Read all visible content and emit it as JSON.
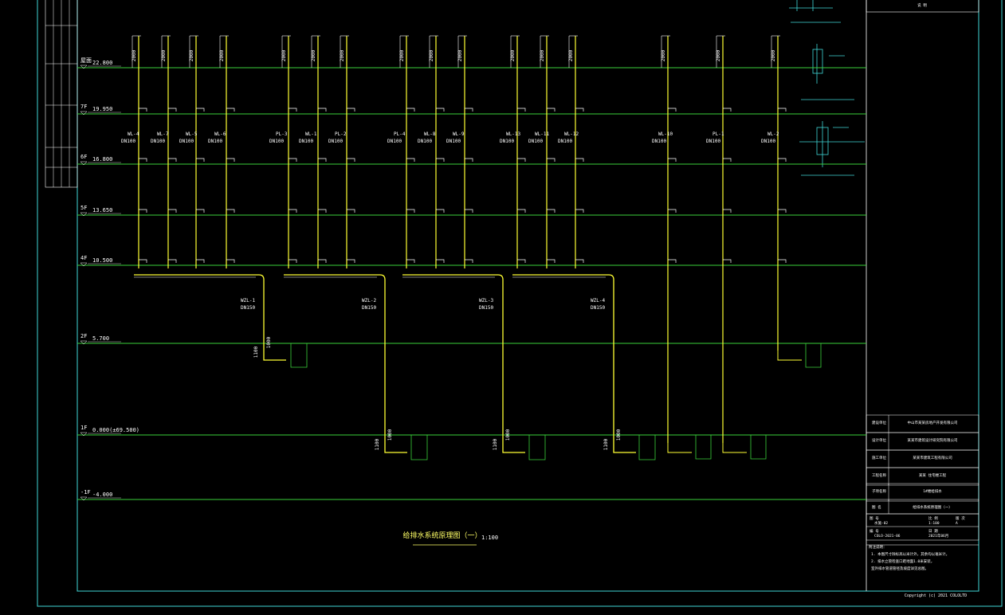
{
  "drawing": {
    "title": "给排水系统原理图（一）",
    "scale": "1:100",
    "copyright": "Copyright (c) 2021 COLOLTD"
  },
  "levels": [
    {
      "label": "22.800",
      "tag": "屋面"
    },
    {
      "label": "19.950",
      "tag": "7F"
    },
    {
      "label": "16.800",
      "tag": "6F"
    },
    {
      "label": "13.650",
      "tag": "5F"
    },
    {
      "label": "10.500",
      "tag": "4F"
    },
    {
      "label": "5.700",
      "tag": "2F"
    },
    {
      "label": "0.000(±69.500)",
      "tag": "1F"
    },
    {
      "label": "-4.000",
      "tag": "-1F"
    }
  ],
  "pipes": [
    {
      "name": "WL-4",
      "size": "DN100",
      "dim": "2000"
    },
    {
      "name": "WL-7",
      "size": "DN100",
      "dim": "2000"
    },
    {
      "name": "WL-5",
      "size": "DN100",
      "dim": "2000"
    },
    {
      "name": "WL-6",
      "size": "DN100",
      "dim": "2000"
    },
    {
      "name": "PL-3",
      "size": "DN100",
      "dim": "2000"
    },
    {
      "name": "WL-1",
      "size": "DN100",
      "dim": "2000"
    },
    {
      "name": "PL-2",
      "size": "DN100",
      "dim": "2000"
    },
    {
      "name": "PL-4",
      "size": "DN100",
      "dim": "2000"
    },
    {
      "name": "WL-8",
      "size": "DN100",
      "dim": "2000"
    },
    {
      "name": "WL-9",
      "size": "DN100",
      "dim": "2000"
    },
    {
      "name": "WL-13",
      "size": "DN100",
      "dim": "2000"
    },
    {
      "name": "WL-11",
      "size": "DN100",
      "dim": "2000"
    },
    {
      "name": "WL-12",
      "size": "DN100",
      "dim": "2000"
    },
    {
      "name": "WL-10",
      "size": "DN100",
      "dim": "2000"
    },
    {
      "name": "PL-1",
      "size": "DN100",
      "dim": "2000"
    },
    {
      "name": "WL-2",
      "size": "DN100",
      "dim": "2000"
    }
  ],
  "mains": [
    {
      "name": "WZL-1",
      "size": "DN150"
    },
    {
      "name": "WZL-2",
      "size": "DN150"
    },
    {
      "name": "WZL-3",
      "size": "DN150"
    },
    {
      "name": "WZL-4",
      "size": "DN150"
    }
  ],
  "dims": {
    "a": "1100",
    "b": "1000"
  },
  "sheet": {
    "header": "说 明",
    "rows": [
      {
        "key": "建设单位",
        "value": "中山市某某房地产开发有限公司"
      },
      {
        "key": "设计单位",
        "value": "某某市建筑设计研究院有限公司"
      },
      {
        "key": "施工单位",
        "value": "某某市建筑工程有限公司"
      },
      {
        "key": "工程名称",
        "value": "某某 住宅楼工程"
      },
      {
        "key": "子项名称",
        "value": "1#楼给排水"
      },
      {
        "key": "图 名",
        "value": "给排水系统原理图（一）"
      }
    ],
    "meta": [
      {
        "key": "图 号",
        "value": "水施-02"
      },
      {
        "key": "比 例",
        "value": "1:100"
      },
      {
        "key": "版 次",
        "value": "A"
      },
      {
        "key": "编 号",
        "value": "COLO-2021-06"
      },
      {
        "key": "日 期",
        "value": "2021年06月"
      }
    ],
    "notes_title": "附注说明：",
    "notes": [
      "1. 本图尺寸除标高以米计外，其余均以毫米计。",
      "2. 排水立管检查口距地面1.0米安装，",
      "   室外排水管道管径及坡度详见总图。"
    ]
  }
}
